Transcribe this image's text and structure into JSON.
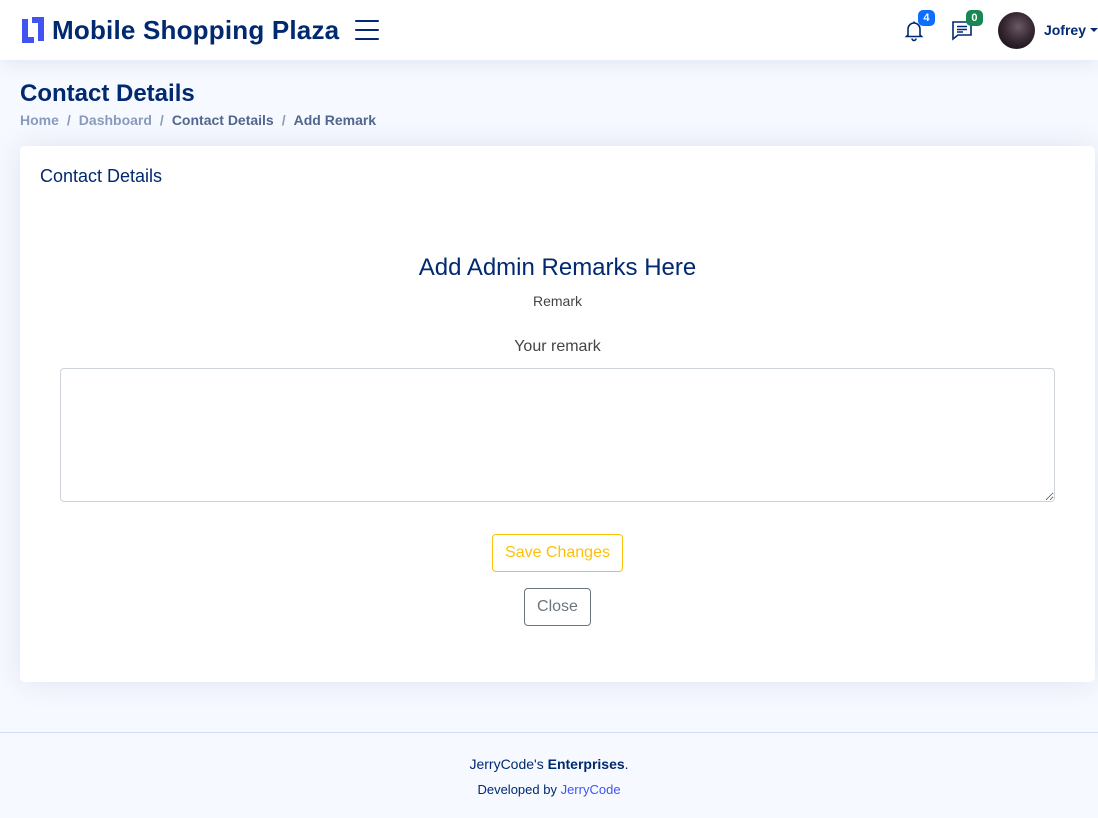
{
  "header": {
    "brand": "Mobile Shopping Plaza",
    "notifications_count": "4",
    "messages_count": "0",
    "user_name": "Jofrey",
    "colors": {
      "brand": "#012970",
      "logo": "#4154f1",
      "notif_badge": "#0d6efd",
      "msg_badge": "#198754"
    }
  },
  "pagetitle": {
    "title": "Contact Details",
    "breadcrumb": {
      "home": "Home",
      "dashboard": "Dashboard",
      "contact_details": "Contact Details",
      "current": "Add Remark",
      "separator": "/"
    }
  },
  "card": {
    "title": "Contact Details",
    "heading": "Add Admin Remarks Here",
    "subheading": "Remark",
    "field_label": "Your remark",
    "remark_value": "",
    "save_label": "Save Changes",
    "close_label": "Close",
    "colors": {
      "save": "#ffc107",
      "close": "#6c757d"
    }
  },
  "footer": {
    "company_prefix": "JerryCode's",
    "company_bold": "Enterprises",
    "company_suffix": ".",
    "developed_prefix": "Developed by",
    "developer_link": "JerryCode"
  },
  "icons": [
    "logo-icon",
    "menu-toggle-icon",
    "bell-icon",
    "chat-icon",
    "caret-down-icon"
  ]
}
